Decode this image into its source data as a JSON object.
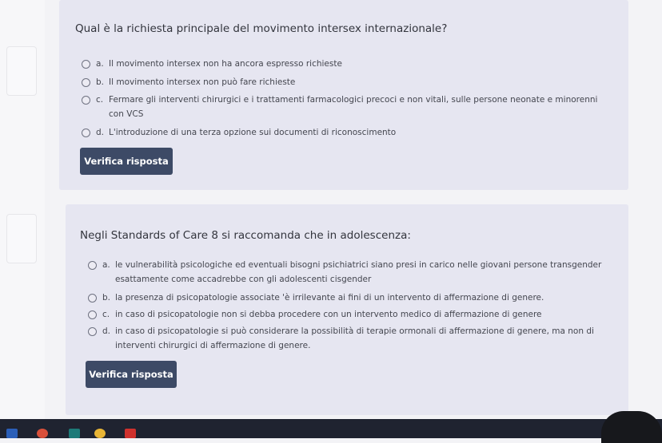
{
  "quiz": {
    "q1": {
      "question": "Qual è la richiesta principale del movimento intersex internazionale?",
      "options": [
        {
          "letter": "a.",
          "text": "Il movimento intersex non ha ancora espresso richieste"
        },
        {
          "letter": "b.",
          "text": "Il movimento intersex non può fare richieste"
        },
        {
          "letter": "c.",
          "text": "Fermare gli interventi chirurgici e i trattamenti farmacologici precoci e non vitali, sulle persone neonate e minorenni con VCS"
        },
        {
          "letter": "d.",
          "text": "L'introduzione di una terza opzione sui documenti di riconoscimento"
        }
      ],
      "button": "Verifica risposta"
    },
    "q2": {
      "question": "Negli Standards of Care 8 si raccomanda che in adolescenza:",
      "options": [
        {
          "letter": "a.",
          "text": "le vulnerabilità psicologiche ed eventuali bisogni psichiatrici siano presi in carico nelle giovani persone transgender esattamente come accadrebbe con gli adolescenti cisgender"
        },
        {
          "letter": "b.",
          "text": "la presenza di psicopatologie associate 'è irrilevante ai fini di un intervento di affermazione di genere."
        },
        {
          "letter": "c.",
          "text": "in caso di psicopatologie non si debba procedere con un intervento medico di affermazione di genere"
        },
        {
          "letter": "d.",
          "text": "in caso di psicopatologie si può considerare la possibilità di terapie ormonali di affermazione di genere, ma non di interventi chirurgici di affermazione di genere."
        }
      ],
      "button": "Verifica risposta"
    }
  },
  "taskbar": {
    "icons": [
      "word-icon",
      "app-icon",
      "publisher-icon",
      "chrome-icon",
      "acrobat-icon"
    ]
  }
}
